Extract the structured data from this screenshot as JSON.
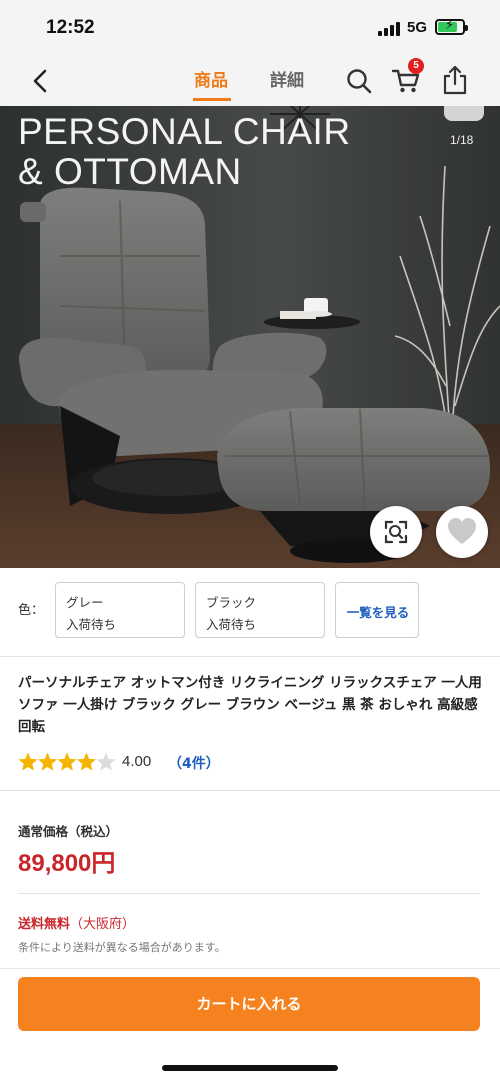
{
  "status_bar": {
    "time": "12:52",
    "network": "5G",
    "battery_level": 0.8
  },
  "nav": {
    "tabs": [
      {
        "label": "商品",
        "active": true
      },
      {
        "label": "詳細",
        "active": false
      }
    ],
    "cart_badge": "5",
    "accent_color": "#f07c19"
  },
  "hero": {
    "title_line1": "PERSONAL CHAIR",
    "title_line2": "& OTTOMAN",
    "counter": "1/18"
  },
  "colors": {
    "label": "色：",
    "options": [
      {
        "name": "グレー",
        "stock": "入荷待ち"
      },
      {
        "name": "ブラック",
        "stock": "入荷待ち"
      }
    ],
    "view_all": "一覧を見る"
  },
  "product": {
    "title": "パーソナルチェア オットマン付き リクライニング リラックスチェア 一人用 ソファ 一人掛け ブラック グレー ブラウン ベージュ 黒 茶 おしゃれ 高級感 回転",
    "rating": 4.0,
    "rating_text": "4.00",
    "review_count": "（4件）",
    "star_color": "#f5b400"
  },
  "price": {
    "label": "通常価格（税込）",
    "value": "89,800円",
    "color": "#c9262b"
  },
  "shipping": {
    "title": "送料無料",
    "region": "（大阪府）",
    "note": "条件により送料が異なる場合があります。"
  },
  "cart_button": {
    "label": "カートに入れる",
    "color": "#f5821f"
  }
}
